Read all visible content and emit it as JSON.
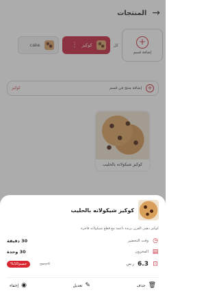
{
  "header": {
    "title": "المنتجات",
    "back_icon": "arrow-right-icon"
  },
  "categories": {
    "add_label": "إضافة قسم",
    "small_label": "كل",
    "chips": [
      {
        "label": "كوكيز",
        "active": true
      },
      {
        "label": "cake",
        "active": false
      }
    ]
  },
  "add_product": {
    "label": "إضافة منتج في قسم",
    "category": "كوكيز"
  },
  "product_tile": {
    "name": "كوكيز شيكولاته بالحليب"
  },
  "sheet": {
    "title": "كوكيز شيكولاته بالحليب",
    "description": "كوكيز ذهبي الفرن بزبدة ناعمة مع قطع شيكولاته فاخرة",
    "prep": {
      "label": "وقت التحضير",
      "value": "30 دقيقة"
    },
    "stock": {
      "label": "المخزون",
      "value": "30 وحدة"
    },
    "price": {
      "value": "6.3",
      "currency": "ر.س",
      "old": "7 ر.س",
      "discount": "خصم10%"
    },
    "actions": {
      "delete": "حذف",
      "edit": "تعديل",
      "hide": "إخفاء"
    }
  },
  "colors": {
    "accent": "#c62834",
    "chip_active": "#c3203a",
    "discount": "#d7262f"
  }
}
